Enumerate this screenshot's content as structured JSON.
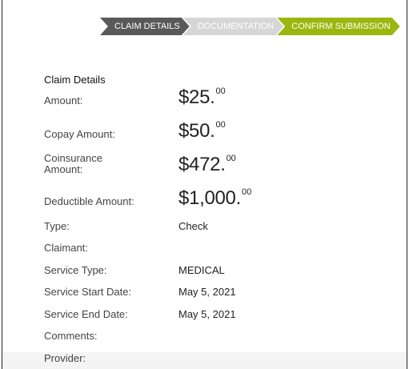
{
  "stepper": {
    "steps": [
      {
        "label": "CLAIM DETAILS"
      },
      {
        "label": "DOCUMENTATION"
      },
      {
        "label": "CONFIRM SUBMISSION"
      }
    ]
  },
  "section": {
    "title": "Claim Details"
  },
  "amounts": {
    "amount": {
      "label": "Amount:",
      "main": "$25.",
      "cents": "00"
    },
    "copay": {
      "label": "Copay Amount:",
      "main": "$50.",
      "cents": "00"
    },
    "coinsurance": {
      "label_line1": "Coinsurance",
      "label_line2": "Amount:",
      "main": "$472.",
      "cents": "00"
    },
    "deductible": {
      "label": "Deductible Amount:",
      "main": "$1,000.",
      "cents": "00"
    }
  },
  "details": {
    "type": {
      "label": "Type:",
      "value": "Check"
    },
    "claimant": {
      "label": "Claimant:",
      "value": ""
    },
    "service_type": {
      "label": "Service Type:",
      "value": "MEDICAL"
    },
    "service_start": {
      "label": "Service Start Date:",
      "value": "May 5, 2021"
    },
    "service_end": {
      "label": "Service End Date:",
      "value": "May 5, 2021"
    },
    "comments": {
      "label": "Comments:",
      "value": ""
    },
    "provider": {
      "label": "Provider:",
      "value": ""
    }
  },
  "colors": {
    "step_active": "#9bb70f",
    "step_done": "#595959",
    "step_pending": "#d6d6d6"
  }
}
